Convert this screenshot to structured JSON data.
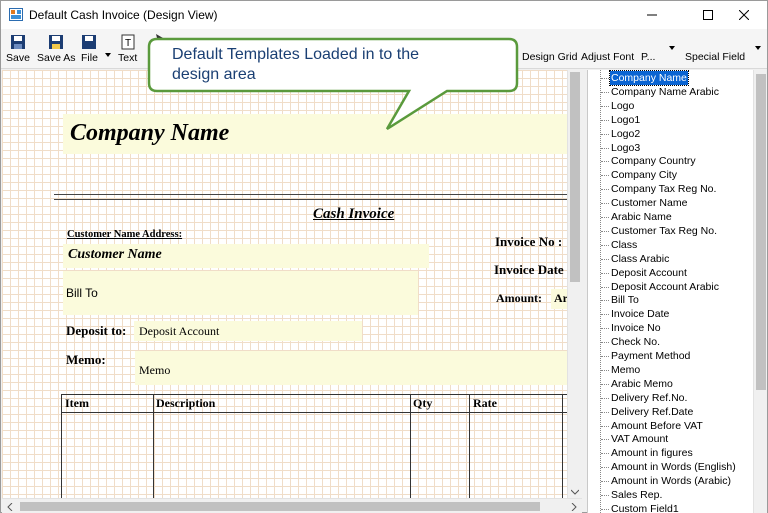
{
  "window": {
    "title": "Default Cash Invoice (Design View)"
  },
  "toolbar": {
    "save": "Save",
    "save_as": "Save As",
    "file": "File",
    "text": "Text",
    "design_grid": "Design Grid",
    "adjust_font": "Adjust Font",
    "p_menu": "P...",
    "special_field": "Special Field"
  },
  "callout": {
    "line1": "Default Templates Loaded in to the",
    "line2": "design area"
  },
  "invoice": {
    "company_name": "Company Name",
    "title": "Cash Invoice",
    "customer_name_address": "Customer Name Address:",
    "customer_name": "Customer Name",
    "invoice_no": "Invoice No :",
    "invoice_date": "Invoice Date",
    "amount": "Amount:",
    "amount_value": "Ar",
    "bill_to": "Bill To",
    "deposit_to": "Deposit to:",
    "deposit_account": "Deposit Account",
    "memo_label": "Memo:",
    "memo_value": "Memo",
    "columns": [
      "Item",
      "Description",
      "Qty",
      "Rate"
    ]
  },
  "field_list": [
    "Company Name",
    "Company Name Arabic",
    "Logo",
    "Logo1",
    "Logo2",
    "Logo3",
    "Company Country",
    "Company City",
    "Company Tax Reg No.",
    "Customer Name",
    "Arabic Name",
    "Customer Tax Reg No.",
    "Class",
    "Class Arabic",
    "Deposit Account",
    "Deposit Account Arabic",
    "Bill To",
    "Invoice Date",
    "Invoice No",
    "Check No.",
    "Payment Method",
    "Memo",
    "Arabic Memo",
    "Delivery Ref.No.",
    "Delivery Ref.Date",
    "Amount Before VAT",
    "VAT Amount",
    "Amount in figures",
    "Amount in Words (English)",
    "Amount in Words (Arabic)",
    "Sales Rep.",
    "Custom Field1"
  ],
  "colors": {
    "selection": "#0a64d2",
    "field_bg": "#fbfbdc",
    "callout_border": "#5a9a3c"
  }
}
